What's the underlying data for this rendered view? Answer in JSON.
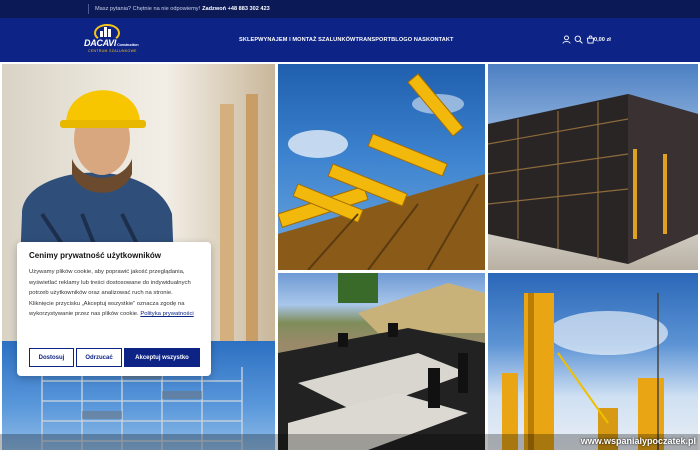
{
  "topbar": {
    "message": "Masz pytania? Chętnie na nie odpowiemy!",
    "phone": "Zadzwoń +48 883 302 423"
  },
  "logo": {
    "name": "DACAVI",
    "sub": "Construction",
    "tagline": "CENTRUM SZALUNKOWE"
  },
  "nav": {
    "items": [
      {
        "label": "SKLEP"
      },
      {
        "label": "WYNAJEM I MONTAŻ SZALUNKÓW"
      },
      {
        "label": "TRANSPORT"
      },
      {
        "label": "BLOG"
      },
      {
        "label": "O NAS"
      },
      {
        "label": "KONTAKT"
      }
    ]
  },
  "header_icons": [
    "user-icon",
    "search-icon",
    "cart-icon"
  ],
  "cart": {
    "total": "0,00 zł"
  },
  "cookie": {
    "title": "Cenimy prywatność użytkowników",
    "body": "Używamy plików cookie, aby poprawić jakość przeglądania, wyświetlać reklamy lub treści dostosowane do indywidualnych potrzeb użytkowników oraz analizować ruch na stronie. Kliknięcie przycisku „Akceptuj wszystkie” oznacza zgodę na wykorzystywanie przez nas plików cookie.",
    "policy_link": "Polityka prywatności",
    "buttons": {
      "customize": "Dostosuj",
      "reject": "Odrzucać",
      "accept": "Akceptuj wszystko"
    }
  },
  "watermark": "www.wspanialypoczatek.pl",
  "colors": {
    "brand_navy": "#0d2385",
    "topbar": "#0b1a57",
    "accent_yellow": "#f5c518"
  }
}
